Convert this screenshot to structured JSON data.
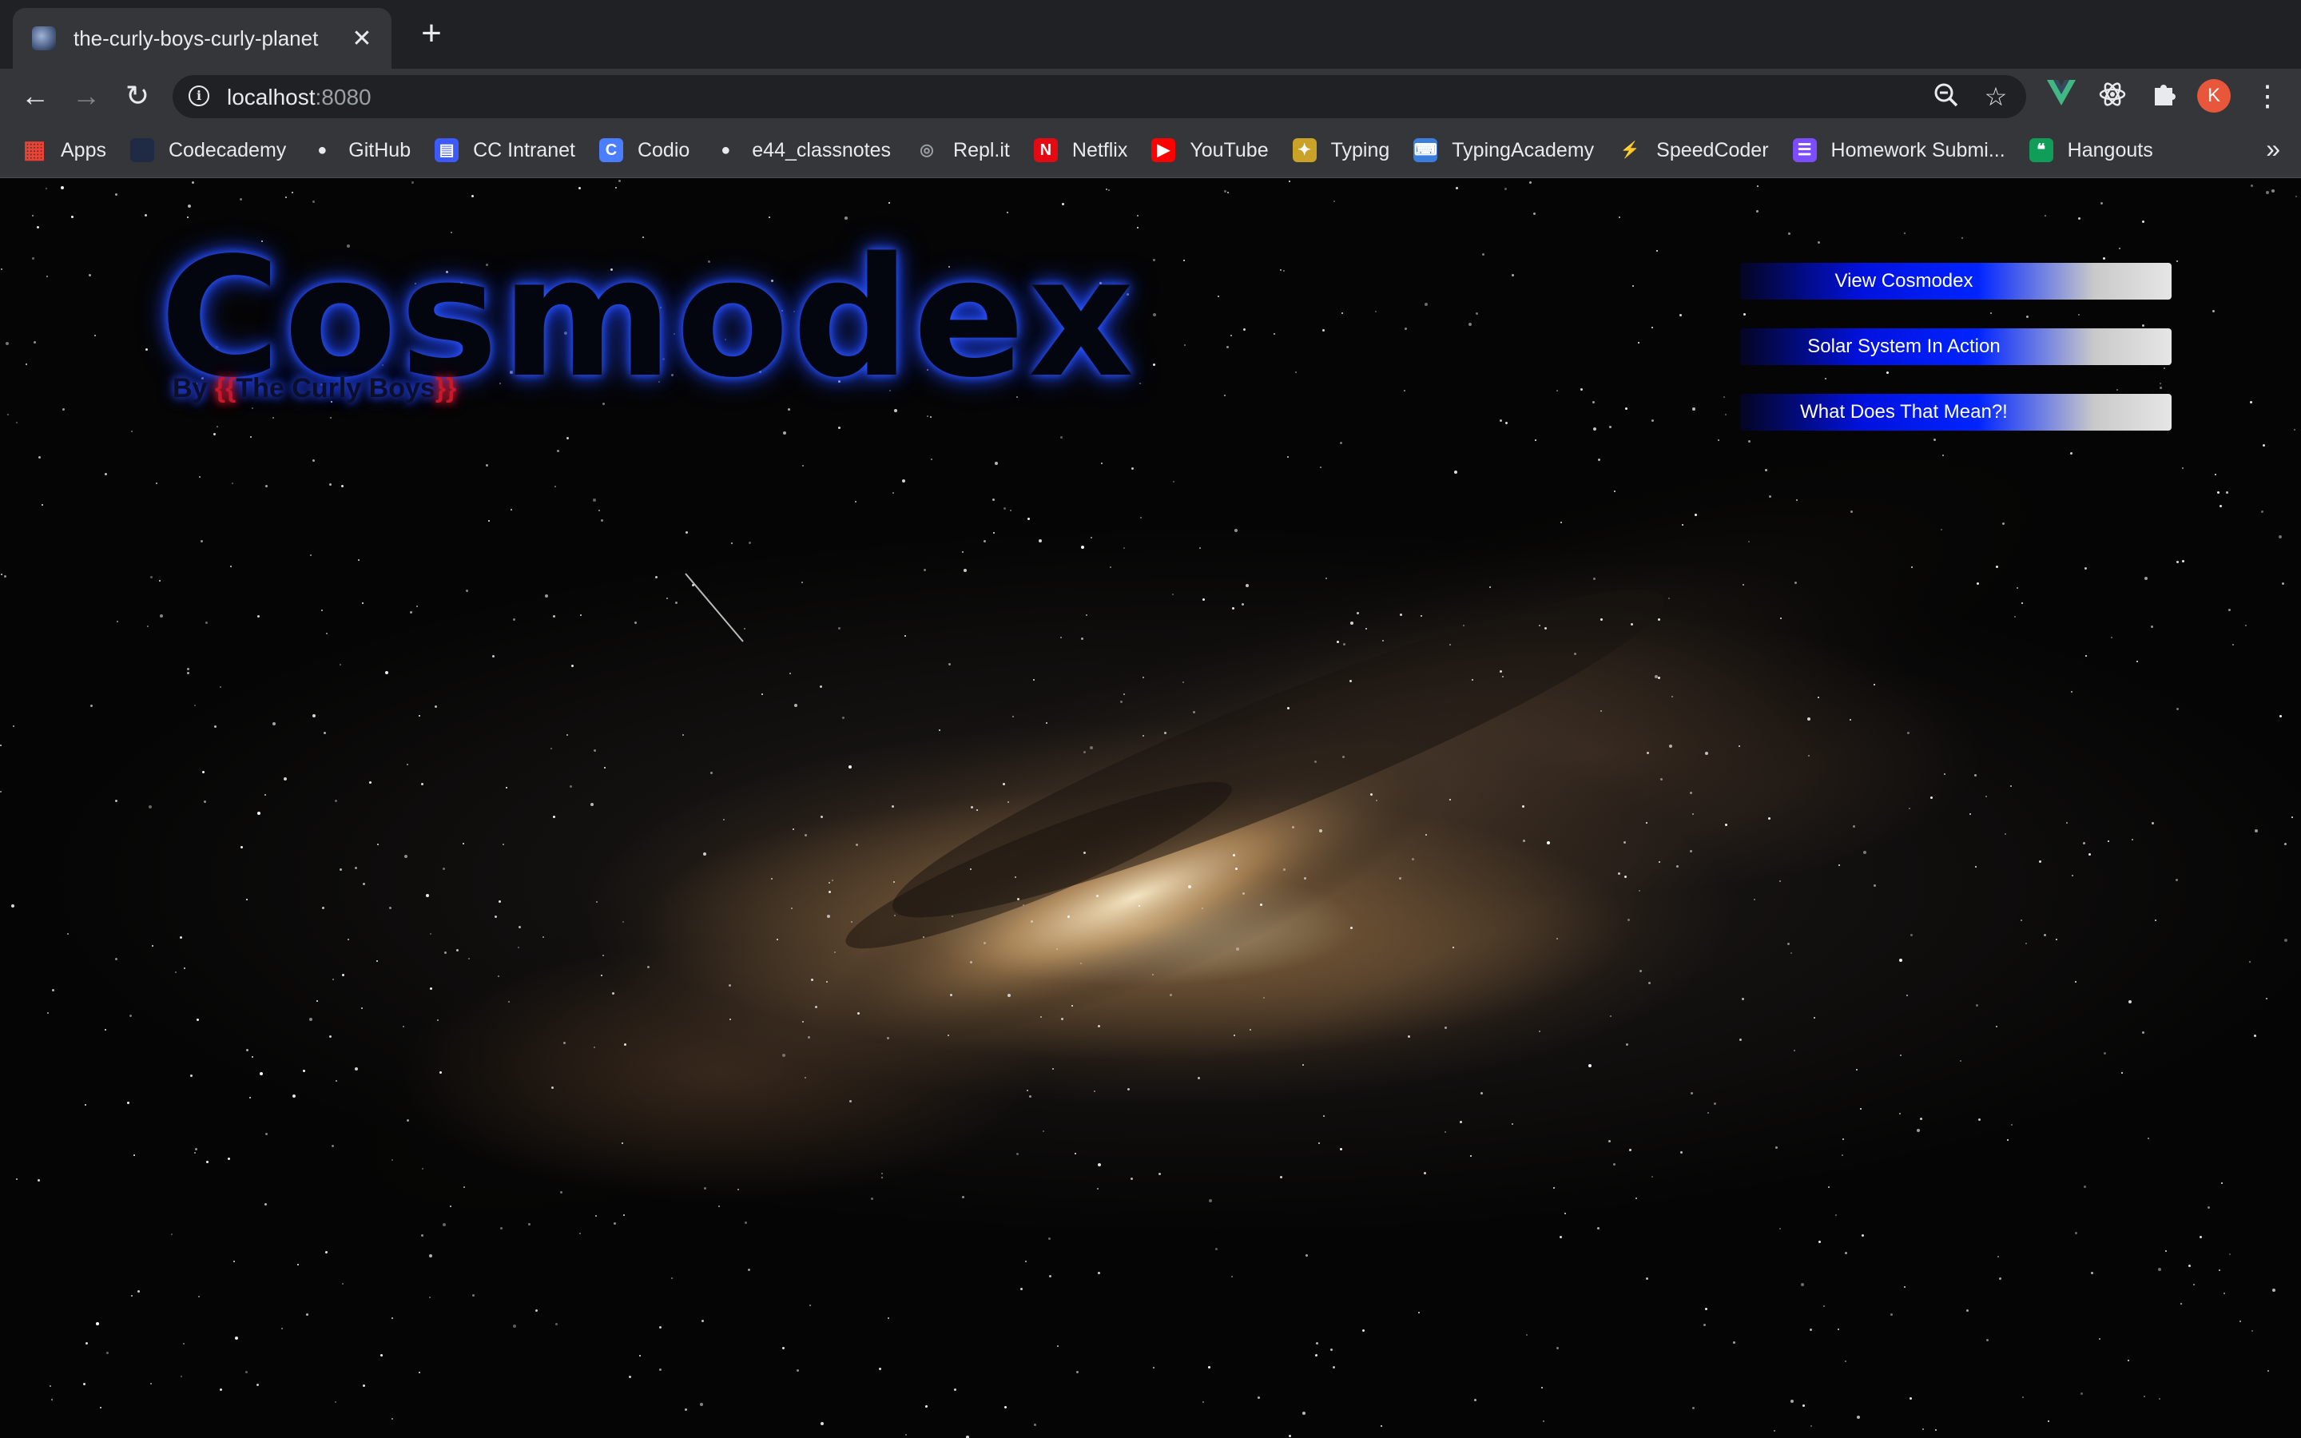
{
  "browser": {
    "tab": {
      "title": "the-curly-boys-curly-planet",
      "close": "✕"
    },
    "new_tab": "+",
    "nav": {
      "back": "←",
      "forward": "→",
      "reload": "↻"
    },
    "url": {
      "host": "localhost",
      "port": ":8080"
    },
    "profile_initial": "K",
    "bookmarks": [
      {
        "label": "Apps",
        "icon": "apps-grid-icon",
        "color": "#ea4335"
      },
      {
        "label": "Codecademy",
        "icon": "codecademy-icon",
        "color": "#1f2a44"
      },
      {
        "label": "GitHub",
        "icon": "github-icon",
        "color": "#e8eaed"
      },
      {
        "label": "CC Intranet",
        "icon": "cc-intranet-icon",
        "color": "#3d5afe"
      },
      {
        "label": "Codio",
        "icon": "codio-icon",
        "color": "#4a7dff"
      },
      {
        "label": "e44_classnotes",
        "icon": "github-icon",
        "color": "#e8eaed"
      },
      {
        "label": "Repl.it",
        "icon": "replit-icon",
        "color": "#9aa0a6"
      },
      {
        "label": "Netflix",
        "icon": "netflix-icon",
        "color": "#e50914"
      },
      {
        "label": "YouTube",
        "icon": "youtube-icon",
        "color": "#ff0000"
      },
      {
        "label": "Typing",
        "icon": "typing-icon",
        "color": "#c9a227"
      },
      {
        "label": "TypingAcademy",
        "icon": "typingacademy-icon",
        "color": "#3b7ddd"
      },
      {
        "label": "SpeedCoder",
        "icon": "speedcoder-icon",
        "color": "#202124"
      },
      {
        "label": "Homework Submi...",
        "icon": "homework-icon",
        "color": "#7c4dff"
      },
      {
        "label": "Hangouts",
        "icon": "hangouts-icon",
        "color": "#0f9d58"
      }
    ],
    "bookmarks_more": "»"
  },
  "page": {
    "logo": "Cosmodex",
    "byline_prefix": "By ",
    "byline_open": "{{",
    "byline_name": "The Curly Boys",
    "byline_close": "}}",
    "buttons": [
      {
        "label": "View Cosmodex"
      },
      {
        "label": "Solar System In Action"
      },
      {
        "label": "What Does That Mean?!"
      }
    ]
  }
}
